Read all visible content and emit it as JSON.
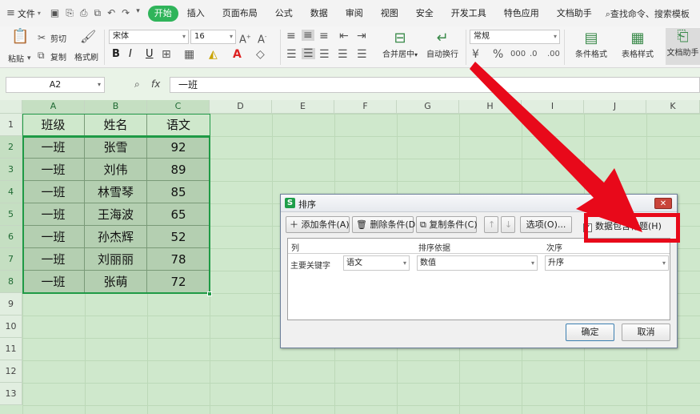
{
  "menubar": {
    "file_label": "文件",
    "tabs": [
      "开始",
      "插入",
      "页面布局",
      "公式",
      "数据",
      "审阅",
      "视图",
      "安全",
      "开发工具",
      "特色应用",
      "文档助手"
    ],
    "active_tab": "开始",
    "search_label": "查找命令、搜索模板"
  },
  "ribbon": {
    "paste": "粘贴",
    "cut": "剪切",
    "copy": "复制",
    "format_painter": "格式刷",
    "font_name": "宋体",
    "font_size": "16",
    "bold": "B",
    "italic": "I",
    "underline": "U",
    "merge_center": "合并居中",
    "wrap_text": "自动换行",
    "number_format": "常规",
    "conditional_format": "条件格式",
    "table_style": "表格样式",
    "doc_helper": "文档助手"
  },
  "formula_bar": {
    "cell_ref": "A2",
    "fx": "fx",
    "value": "一班"
  },
  "columns": [
    "A",
    "B",
    "C",
    "D",
    "E",
    "F",
    "G",
    "H",
    "I",
    "J",
    "K"
  ],
  "rows": [
    "1",
    "2",
    "3",
    "4",
    "5",
    "6",
    "7",
    "8",
    "9",
    "10",
    "11",
    "12",
    "13"
  ],
  "sheet": {
    "headers": [
      "班级",
      "姓名",
      "语文"
    ],
    "data": [
      [
        "一班",
        "张雪",
        "92"
      ],
      [
        "一班",
        "刘伟",
        "89"
      ],
      [
        "一班",
        "林雪琴",
        "85"
      ],
      [
        "一班",
        "王海波",
        "65"
      ],
      [
        "一班",
        "孙杰辉",
        "52"
      ],
      [
        "一班",
        "刘丽丽",
        "78"
      ],
      [
        "一班",
        "张萌",
        "72"
      ]
    ]
  },
  "dialog": {
    "title": "排序",
    "close": "✕",
    "add_condition": "添加条件(A)",
    "delete_condition": "删除条件(D)",
    "copy_condition": "复制条件(C)",
    "options": "选项(O)...",
    "has_header_label": "数据包含标题(H)",
    "has_header_checked": true,
    "col_header": "列",
    "sort_on_header": "排序依据",
    "order_header": "次序",
    "row_label": "主要关键字",
    "key_value": "语文",
    "sort_on_value": "数值",
    "order_value": "升序",
    "ok": "确定",
    "cancel": "取消"
  },
  "colors": {
    "accent": "#2fb45a",
    "grid_bg": "#cfe8cc",
    "highlight_red": "#e8091a"
  }
}
